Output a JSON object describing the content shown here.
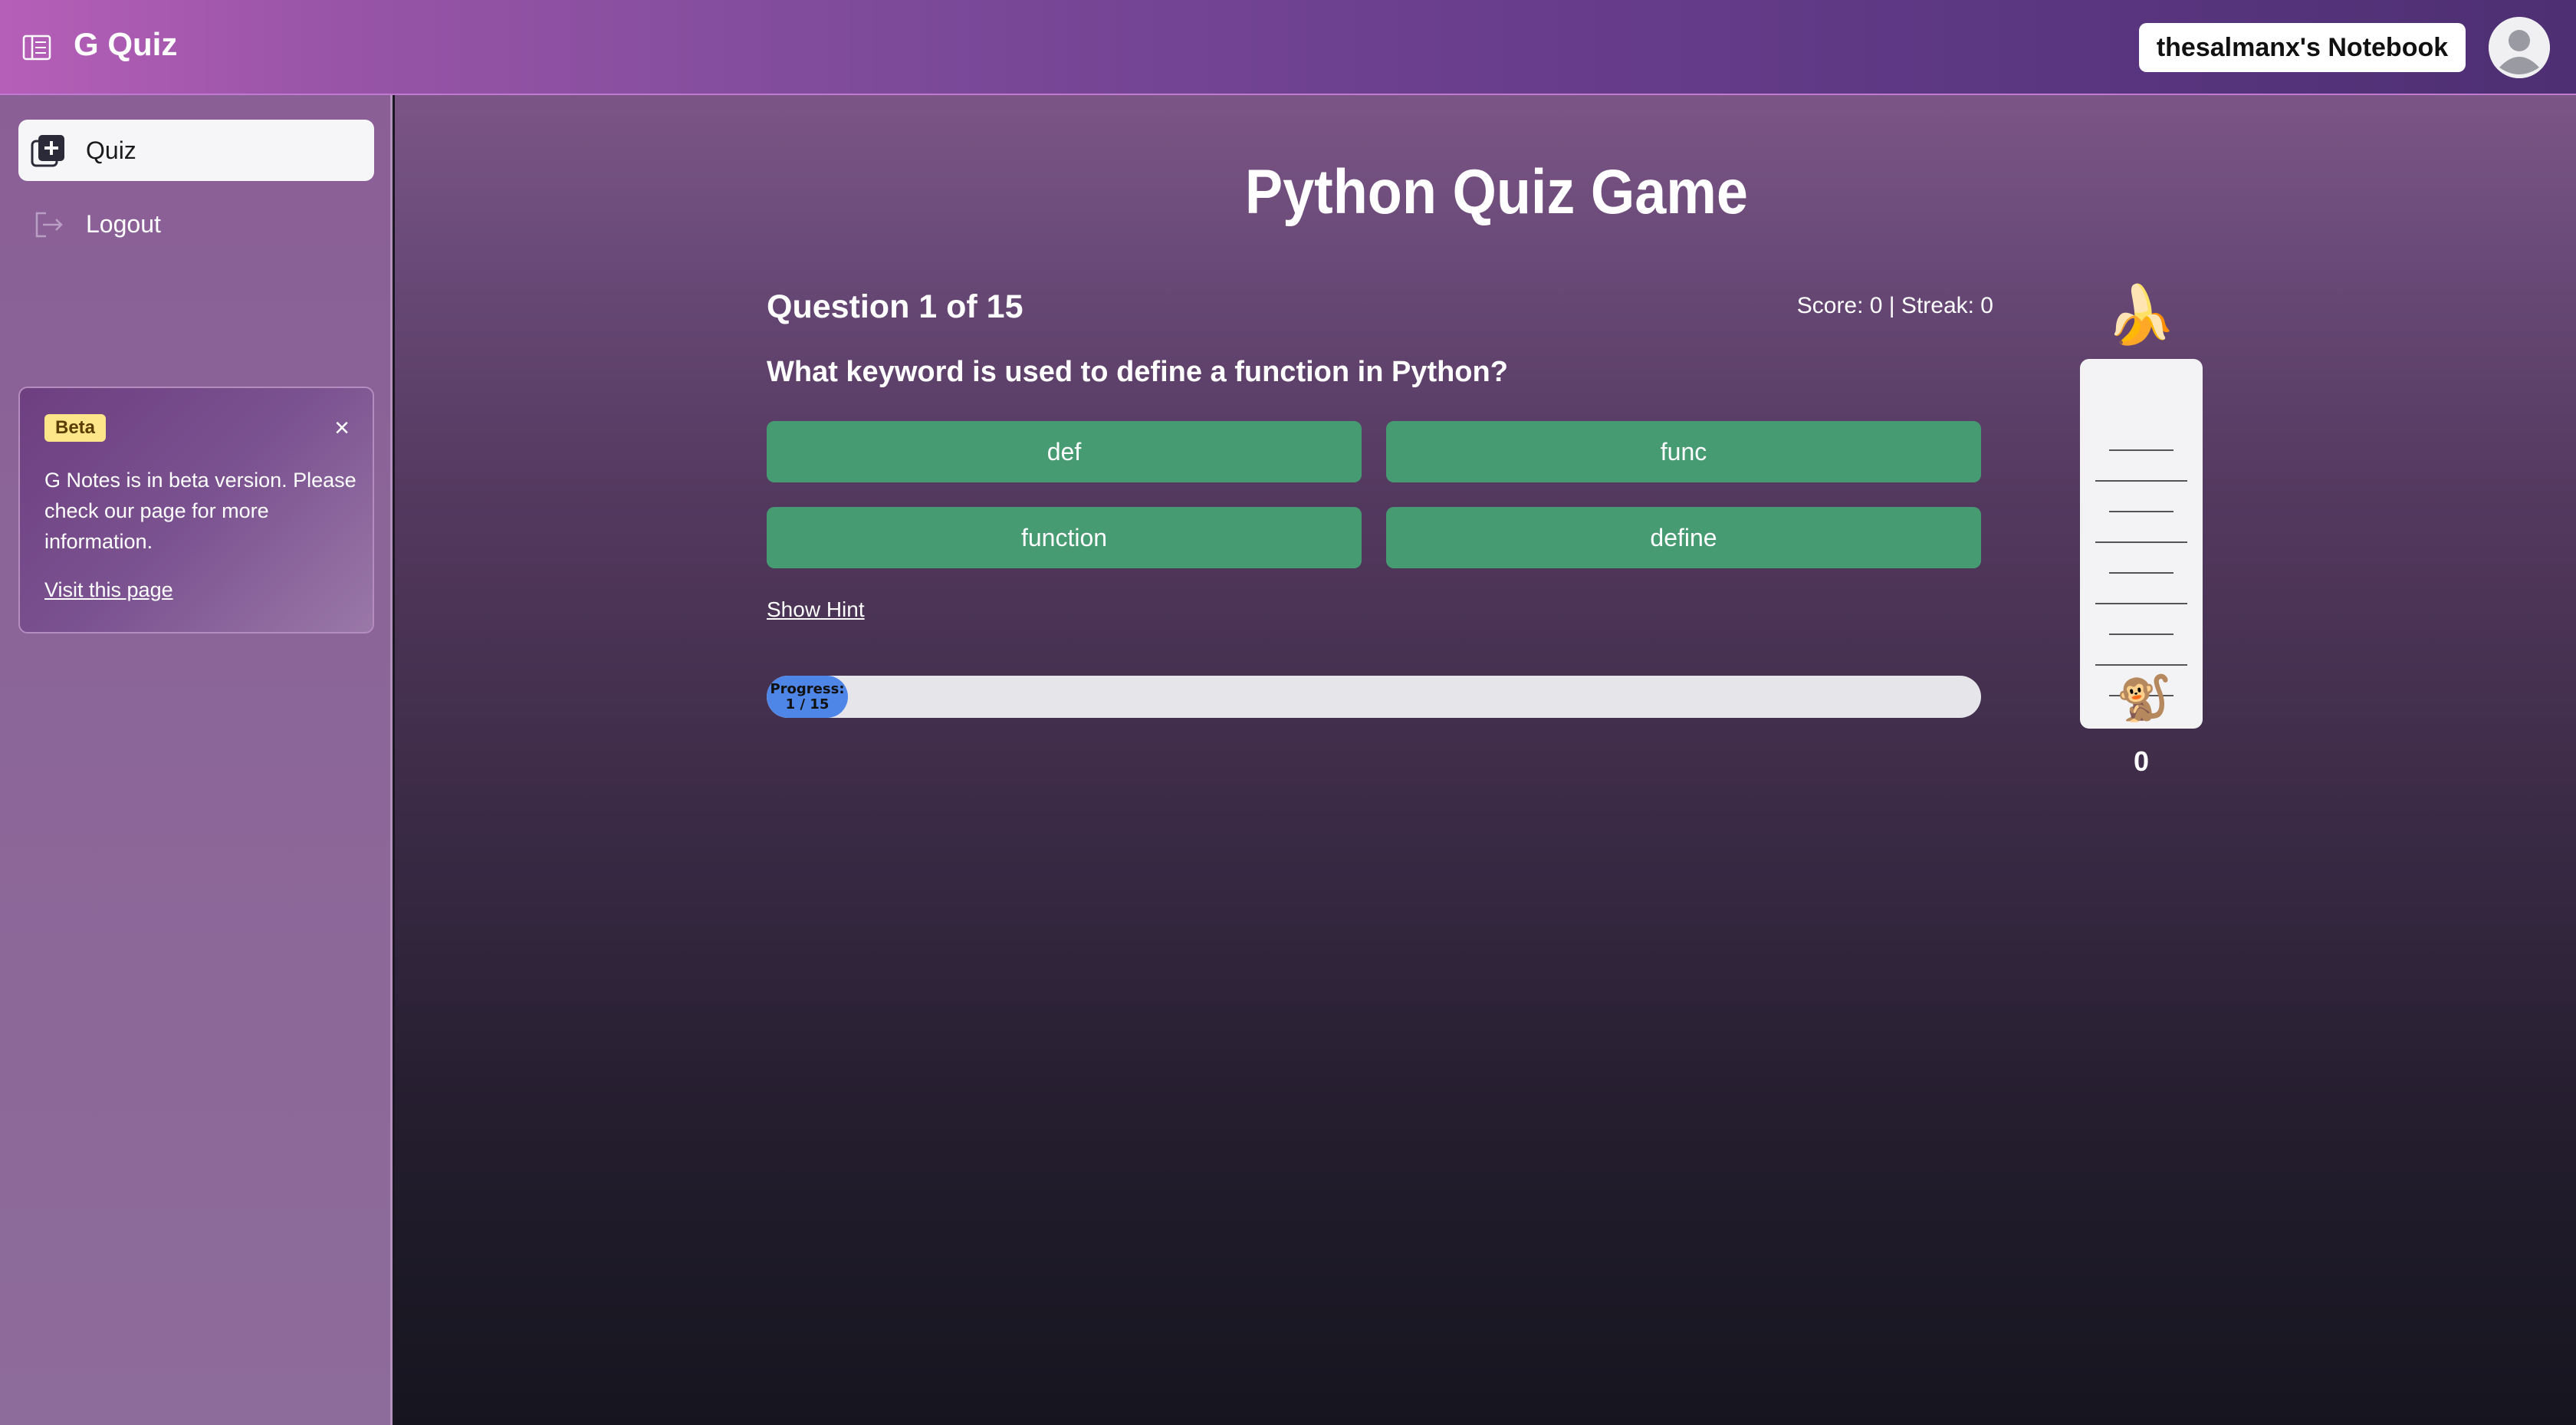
{
  "header": {
    "app_title": "G Quiz",
    "notebook_label": "thesalmanx's Notebook"
  },
  "sidebar": {
    "items": [
      {
        "label": "Quiz",
        "icon": "add-quiz-icon",
        "active": true
      },
      {
        "label": "Logout",
        "icon": "logout-icon",
        "active": false
      }
    ],
    "beta_card": {
      "badge": "Beta",
      "text": "G Notes is in beta version. Please check our page for more information.",
      "link": "Visit this page"
    }
  },
  "main": {
    "title": "Python Quiz Game",
    "question_counter": "Question 1 of 15",
    "score_line": "Score: 0 | Streak: 0",
    "question": "What keyword is used to define a function in Python?",
    "answers": [
      "def",
      "func",
      "function",
      "define"
    ],
    "hint_link": "Show Hint",
    "progress": {
      "label": "Progress:",
      "value_text": "1 / 15",
      "current": 1,
      "total": 15
    },
    "climb_meter": {
      "goal_icon": "banana-icon",
      "climber_icon": "monkey-icon",
      "count": "0"
    }
  },
  "colors": {
    "answer_button": "#469b72",
    "progress_fill": "#4e86e8",
    "beta_badge": "#fde68a"
  }
}
